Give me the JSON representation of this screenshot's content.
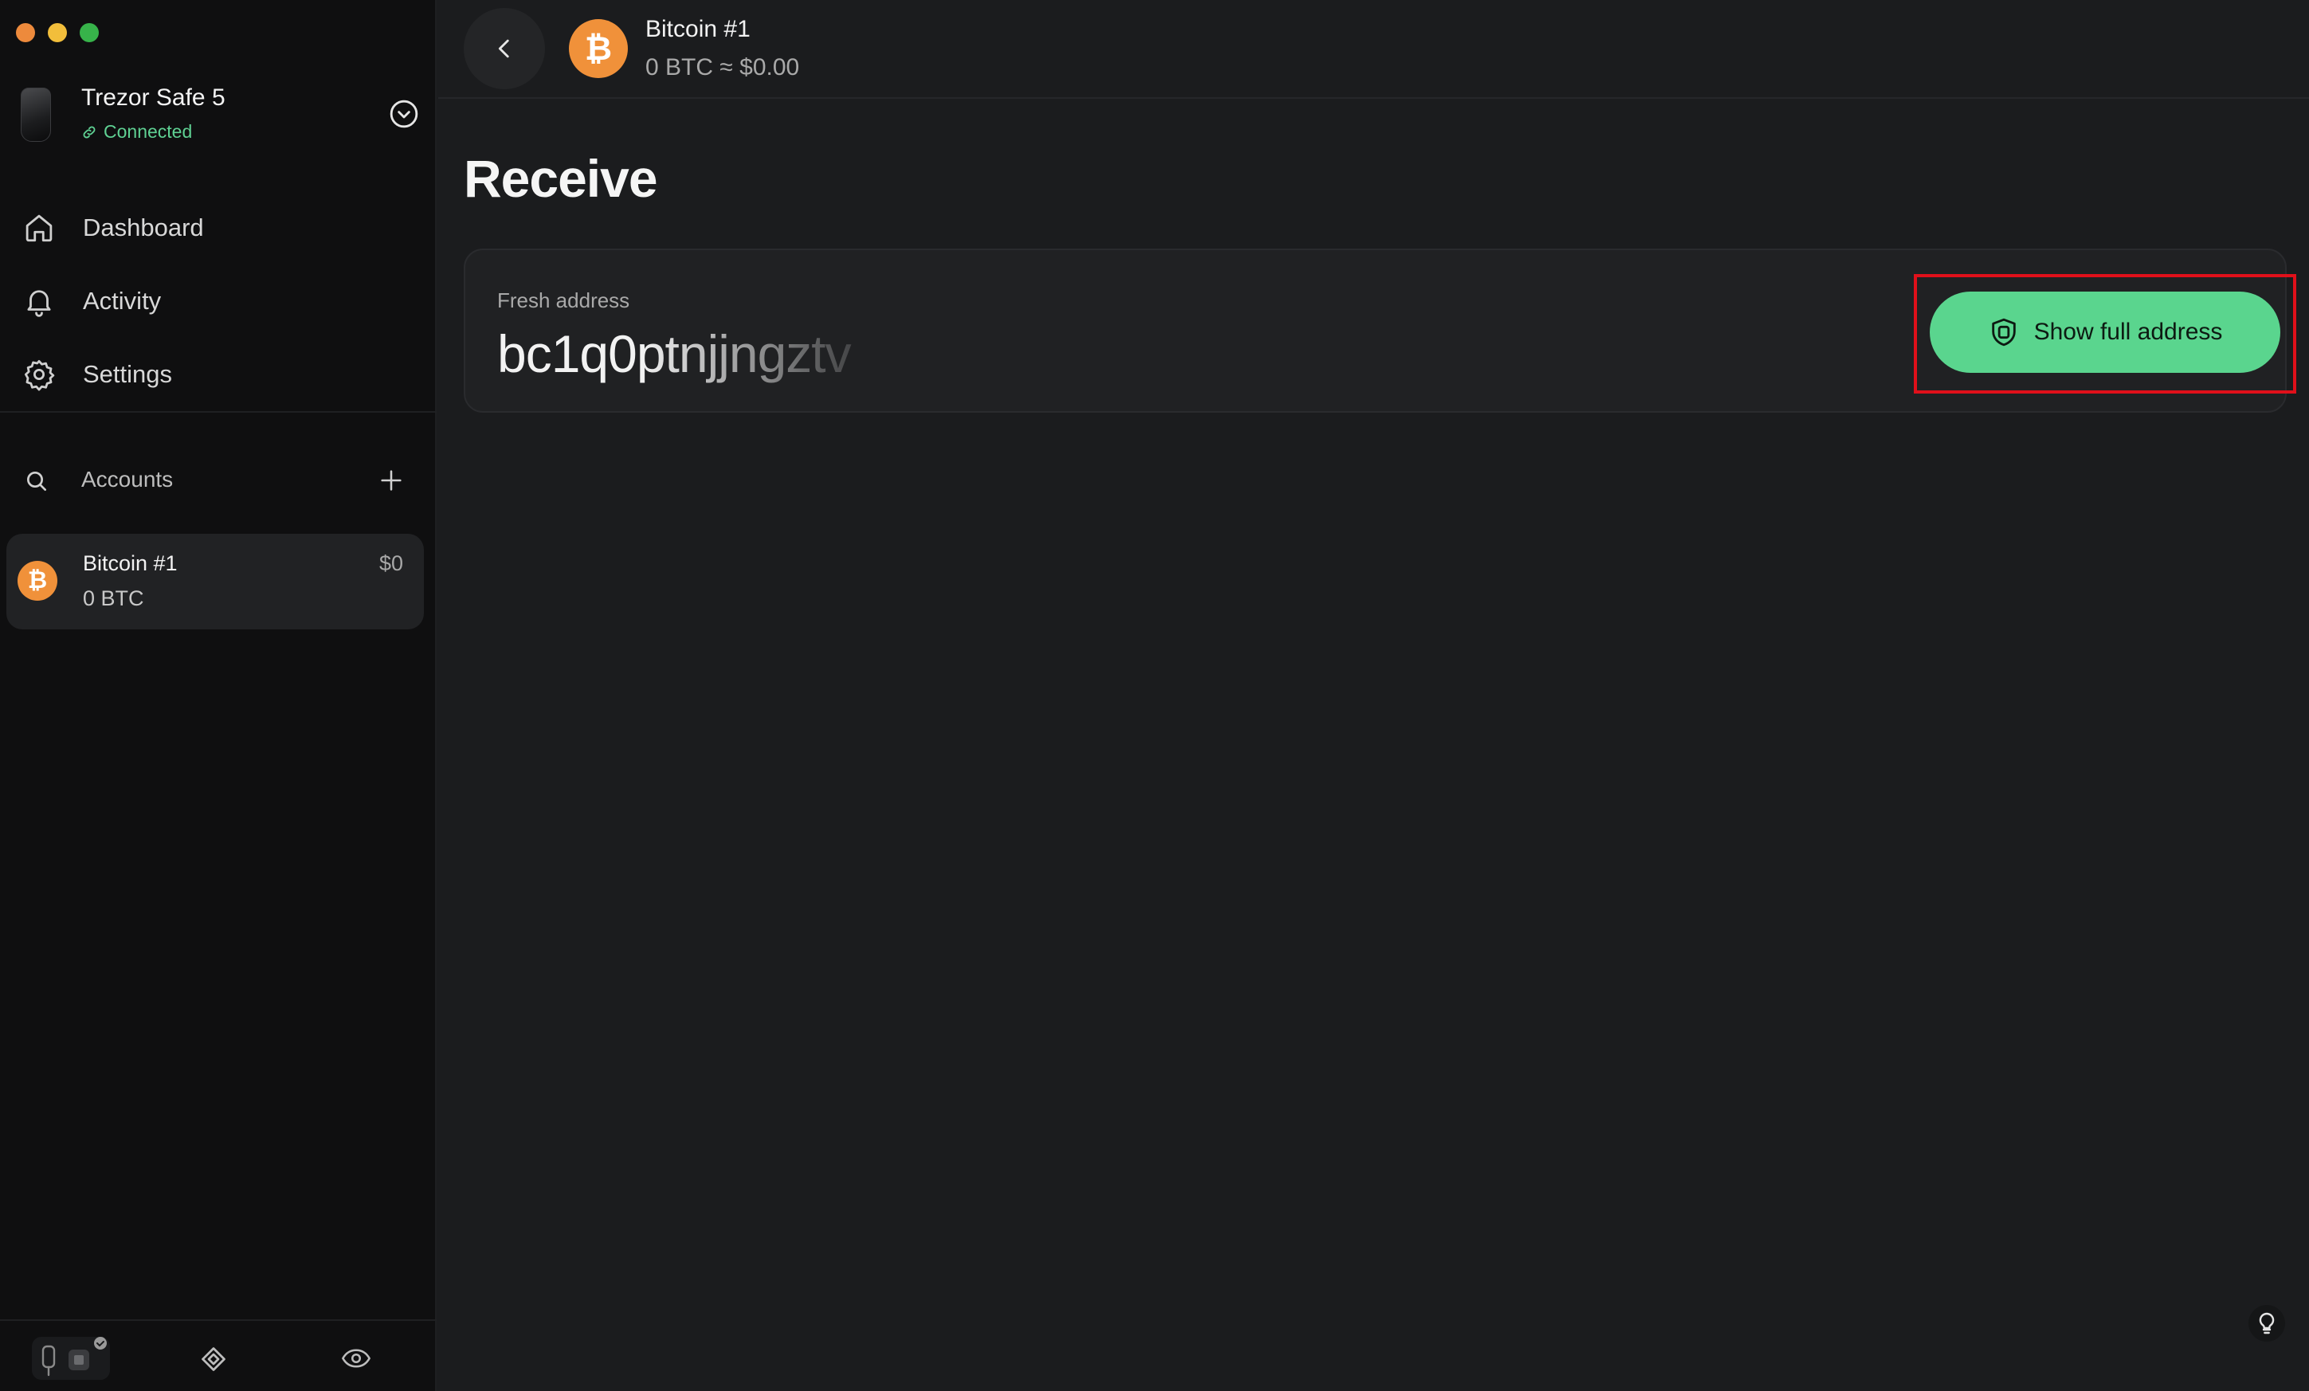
{
  "device": {
    "name": "Trezor Safe 5",
    "status": "Connected"
  },
  "nav": [
    {
      "label": "Dashboard",
      "icon": "home-icon"
    },
    {
      "label": "Activity",
      "icon": "bell-icon"
    },
    {
      "label": "Settings",
      "icon": "gear-icon"
    }
  ],
  "accounts": {
    "header": "Accounts",
    "items": [
      {
        "name": "Bitcoin #1",
        "balance": "0 BTC",
        "fiat": "$0",
        "coin_glyph": "₿"
      }
    ]
  },
  "topbar": {
    "title": "Bitcoin #1",
    "subtitle": "0 BTC ≈ $0.00",
    "coin_glyph": "₿"
  },
  "page": {
    "title": "Receive"
  },
  "receive": {
    "label": "Fresh address",
    "address_preview": "bc1q0ptnjjngztv",
    "button_label": "Show full address"
  },
  "colors": {
    "accent_green": "#5ad58e",
    "bitcoin_orange": "#f0913a",
    "status_green": "#5fd193",
    "highlight_red": "#e0101a"
  }
}
